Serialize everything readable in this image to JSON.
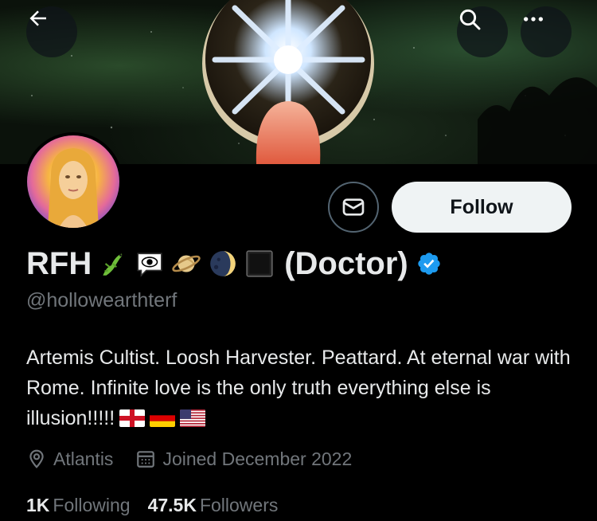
{
  "profile": {
    "display_name": "RFH",
    "name_suffix": "(Doctor)",
    "handle": "@hollowearthterf",
    "verified": true,
    "name_emojis": [
      "lizard-emoji",
      "eye-in-speech-bubble-emoji",
      "ringed-planet-emoji",
      "first-quarter-moon-face-emoji",
      "black-large-square-emoji"
    ],
    "bio_text": "Artemis Cultist. Loosh Harvester. Peattard. At eternal war with Rome. Infinite love is the only truth everything else is illusion!!!!!",
    "bio_flags": [
      "england-flag",
      "germany-flag",
      "usa-flag"
    ],
    "location": "Atlantis",
    "joined": "Joined December 2022",
    "following_count": "1K",
    "following_label": "Following",
    "followers_count": "47.5K",
    "followers_label": "Followers"
  },
  "actions": {
    "follow_label": "Follow"
  },
  "colors": {
    "background": "#000000",
    "text_primary": "#e7e9ea",
    "text_secondary": "#71767b",
    "verified_blue": "#1d9bf0",
    "follow_bg": "#eff3f4"
  }
}
